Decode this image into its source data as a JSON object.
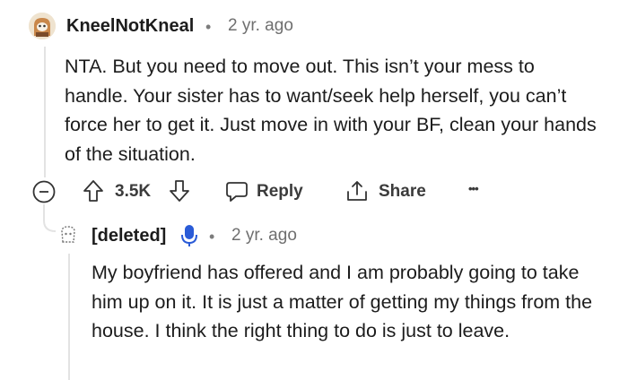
{
  "comment": {
    "username": "KneelNotKneal",
    "separator": "•",
    "timestamp": "2 yr. ago",
    "body": "NTA. But you need to move out. This isn’t your mess to handle. Your sister has to want/seek help herself, you can’t force her to get it. Just move in with your BF, clean your hands of the situation.",
    "actions": {
      "vote_count": "3.5K",
      "reply_label": "Reply",
      "share_label": "Share",
      "more_label": "•••"
    }
  },
  "reply": {
    "username": "[deleted]",
    "separator": "•",
    "timestamp": "2 yr. ago",
    "body": "My boyfriend has offered and I am probably going to take him up on it. It is just a matter of getting my things from the house. I think the right thing to do is just to leave."
  },
  "colors": {
    "text": "#1c1c1c",
    "meta": "#6f6f6f",
    "thread_line": "#e3e3e3",
    "mic_icon": "#2a5bd7"
  }
}
